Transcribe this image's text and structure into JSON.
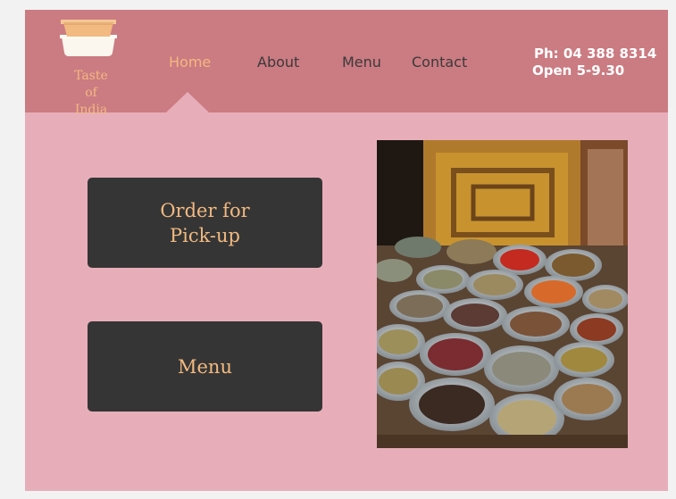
{
  "brand": {
    "logo_lines": [
      "Taste",
      "of",
      "India"
    ],
    "logo_icon": "takeaway-container-icon"
  },
  "nav": {
    "items": [
      {
        "label": "Home",
        "active": true
      },
      {
        "label": "About",
        "active": false
      },
      {
        "label": "Menu",
        "active": false
      },
      {
        "label": "Contact",
        "active": false
      }
    ]
  },
  "contact": {
    "phone": "Ph: 04 388 8314",
    "hours": "Open 5-9.30"
  },
  "actions": {
    "pickup_line1": "Order for",
    "pickup_line2": "Pick-up",
    "menu_label": "Menu"
  },
  "hero_image": {
    "subject": "spice-bowls-photo"
  },
  "colors": {
    "header": "#cb7b82",
    "page": "#e7aeb9",
    "button": "#353535",
    "accent": "#f2b980"
  }
}
